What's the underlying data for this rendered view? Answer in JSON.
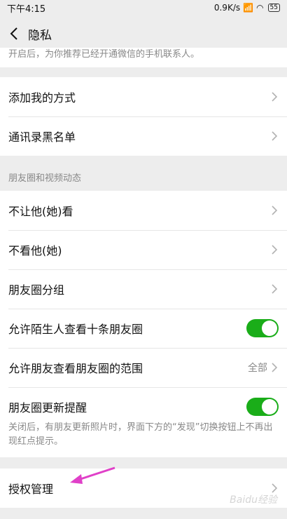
{
  "status_bar": {
    "time": "下午4:15",
    "network_speed": "0.9K/s",
    "battery": "55"
  },
  "nav": {
    "title": "隐私"
  },
  "top_description": "开启后，为你推荐已经开通微信的手机联系人。",
  "group_contacts": {
    "items": [
      {
        "label": "添加我的方式"
      },
      {
        "label": "通讯录黑名单"
      }
    ]
  },
  "moments_section": {
    "header": "朋友圈和视频动态",
    "items": [
      {
        "label": "不让他(她)看"
      },
      {
        "label": "不看他(她)"
      },
      {
        "label": "朋友圈分组"
      },
      {
        "label": "允许陌生人查看十条朋友圈",
        "toggle": true
      },
      {
        "label": "允许朋友查看朋友圈的范围",
        "value": "全部"
      },
      {
        "label": "朋友圈更新提醒",
        "toggle": true
      }
    ],
    "footer_note": "关闭后，有朋友更新照片时，界面下方的“发现”切换按钮上不再出现红点提示。"
  },
  "authorization": {
    "label": "授权管理"
  },
  "watermark": "Baidu经验",
  "colors": {
    "toggle_on": "#1aad19",
    "annotation_arrow": "#e040c8",
    "background": "#ededed"
  }
}
